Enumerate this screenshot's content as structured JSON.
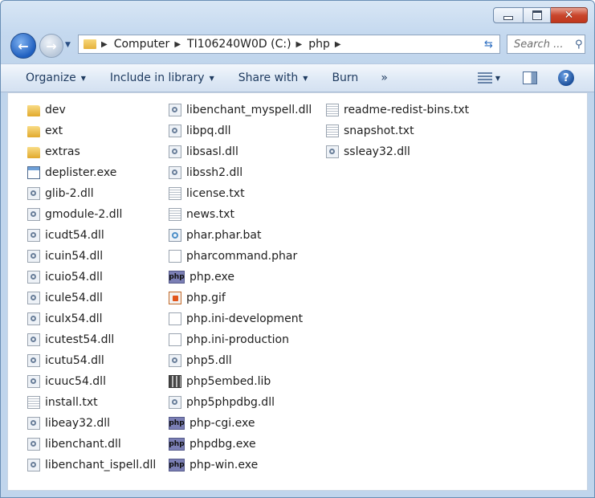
{
  "window": {
    "caption": {
      "minimize": "—",
      "maximize": "□",
      "close": "✕"
    }
  },
  "nav": {
    "back": "←",
    "forward": "→",
    "breadcrumb": [
      "Computer",
      "TI106240W0D (C:)",
      "php"
    ],
    "search_placeholder": "Search ..."
  },
  "toolbar": {
    "items": [
      "Organize",
      "Include in library",
      "Share with",
      "Burn"
    ],
    "more": "»",
    "help": "?"
  },
  "files": {
    "col1": [
      {
        "name": "dev",
        "type": "folder"
      },
      {
        "name": "ext",
        "type": "folder"
      },
      {
        "name": "extras",
        "type": "folder"
      },
      {
        "name": "deplister.exe",
        "type": "exe"
      },
      {
        "name": "glib-2.dll",
        "type": "dll"
      },
      {
        "name": "gmodule-2.dll",
        "type": "dll"
      },
      {
        "name": "icudt54.dll",
        "type": "dll"
      },
      {
        "name": "icuin54.dll",
        "type": "dll"
      },
      {
        "name": "icuio54.dll",
        "type": "dll"
      },
      {
        "name": "icule54.dll",
        "type": "dll"
      },
      {
        "name": "iculx54.dll",
        "type": "dll"
      },
      {
        "name": "icutest54.dll",
        "type": "dll"
      },
      {
        "name": "icutu54.dll",
        "type": "dll"
      },
      {
        "name": "icuuc54.dll",
        "type": "dll"
      },
      {
        "name": "install.txt",
        "type": "txt"
      },
      {
        "name": "libeay32.dll",
        "type": "dll"
      },
      {
        "name": "libenchant.dll",
        "type": "dll"
      },
      {
        "name": "libenchant_ispell.dll",
        "type": "dll"
      }
    ],
    "col2": [
      {
        "name": "libenchant_myspell.dll",
        "type": "dll"
      },
      {
        "name": "libpq.dll",
        "type": "dll"
      },
      {
        "name": "libsasl.dll",
        "type": "dll"
      },
      {
        "name": "libssh2.dll",
        "type": "dll"
      },
      {
        "name": "license.txt",
        "type": "txt"
      },
      {
        "name": "news.txt",
        "type": "txt"
      },
      {
        "name": "phar.phar.bat",
        "type": "bat"
      },
      {
        "name": "pharcommand.phar",
        "type": "doc"
      },
      {
        "name": "php.exe",
        "type": "php"
      },
      {
        "name": "php.gif",
        "type": "gif"
      },
      {
        "name": "php.ini-development",
        "type": "doc"
      },
      {
        "name": "php.ini-production",
        "type": "doc"
      },
      {
        "name": "php5.dll",
        "type": "dll"
      },
      {
        "name": "php5embed.lib",
        "type": "lib"
      },
      {
        "name": "php5phpdbg.dll",
        "type": "dll"
      },
      {
        "name": "php-cgi.exe",
        "type": "php"
      },
      {
        "name": "phpdbg.exe",
        "type": "php"
      },
      {
        "name": "php-win.exe",
        "type": "php"
      }
    ],
    "col3": [
      {
        "name": "readme-redist-bins.txt",
        "type": "txt"
      },
      {
        "name": "snapshot.txt",
        "type": "txt"
      },
      {
        "name": "ssleay32.dll",
        "type": "dll"
      }
    ]
  }
}
